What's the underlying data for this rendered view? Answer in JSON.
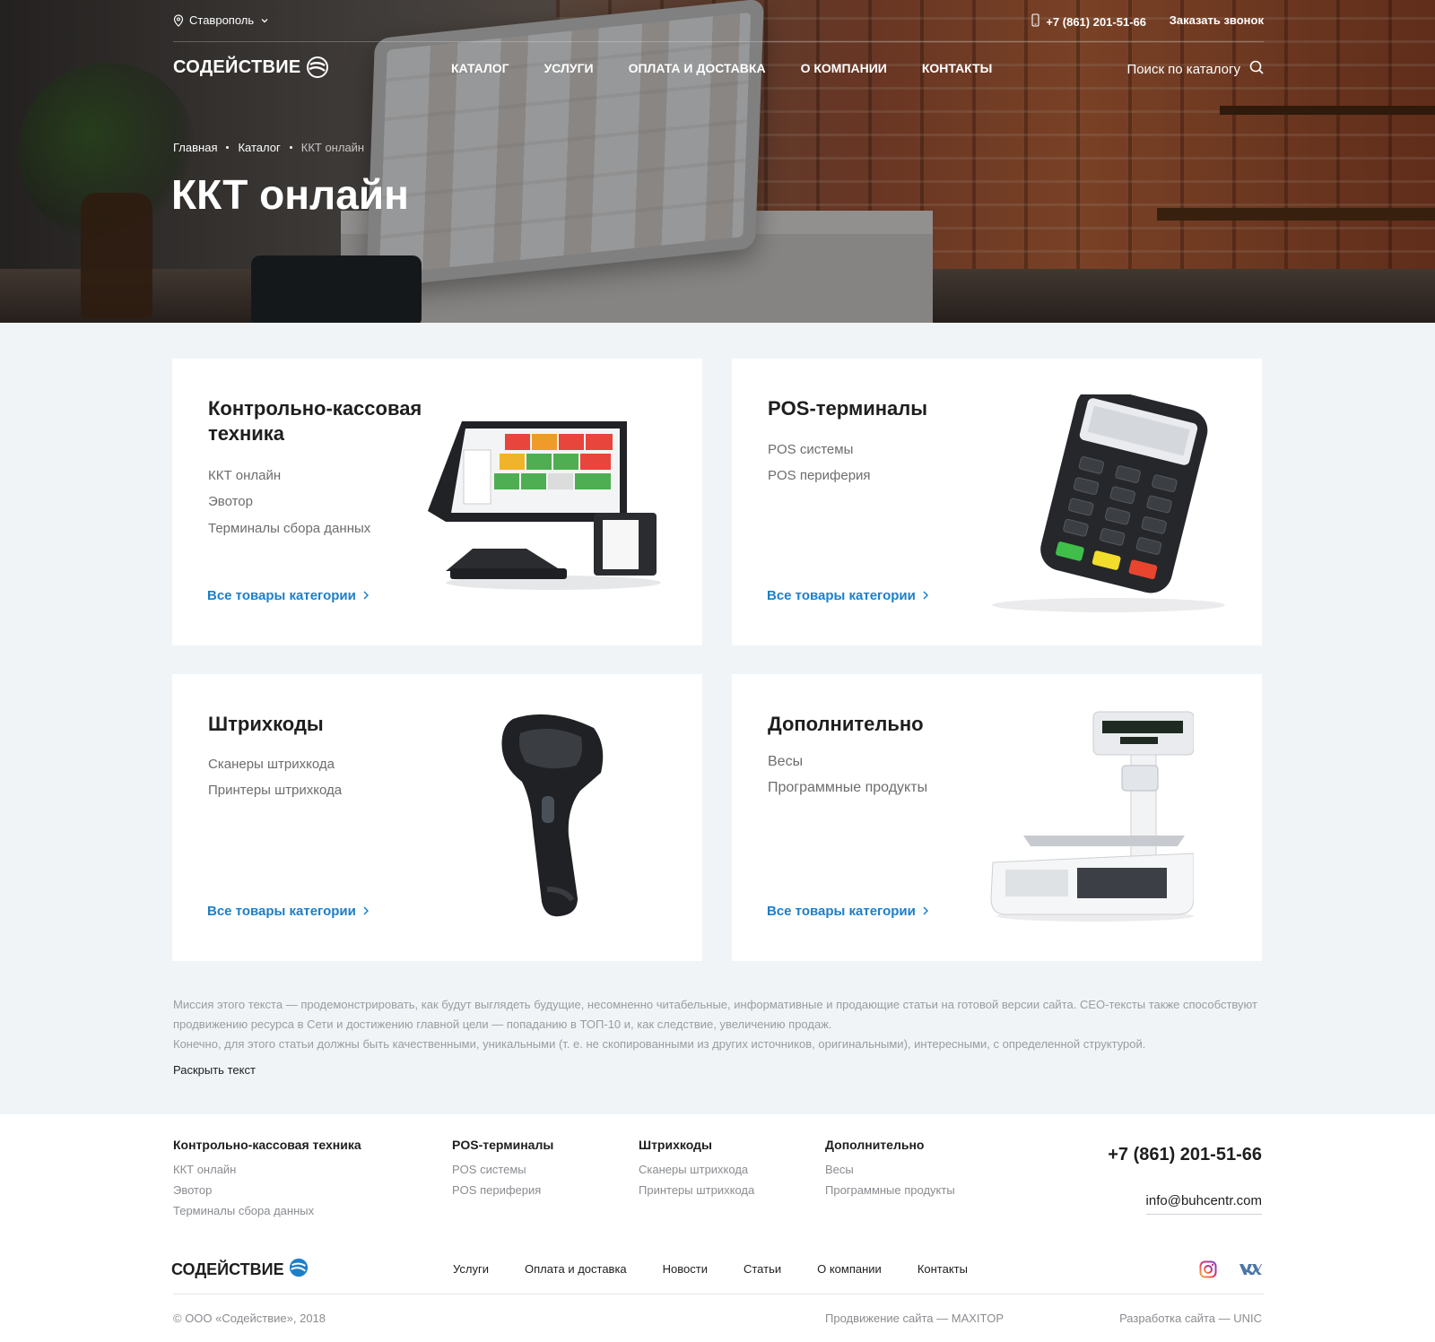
{
  "header": {
    "city": "Ставрополь",
    "phone": "+7 (861) 201-51-66",
    "callback_label": "Заказать звонок",
    "logo_text": "СОДЕЙСТВИЕ",
    "nav": [
      "КАТАЛОГ",
      "УСЛУГИ",
      "ОПЛАТА И ДОСТАВКА",
      "О КОМПАНИИ",
      "КОНТАКТЫ"
    ],
    "search_placeholder": "Поиск по каталогу"
  },
  "breadcrumb": [
    "Главная",
    "Каталог",
    "ККТ онлайн"
  ],
  "page_title": "ККТ онлайн",
  "cards": [
    {
      "title": "Контрольно-кассовая техника",
      "links": [
        "ККТ онлайн",
        "Эвотор",
        "Терминалы сбора данных"
      ],
      "more": "Все товары категории",
      "image": "pos-touch-terminal-icon"
    },
    {
      "title": "POS-терминалы",
      "links": [
        "POS системы",
        "POS периферия"
      ],
      "more": "Все товары категории",
      "image": "payment-terminal-icon"
    },
    {
      "title": "Штрихкоды",
      "links": [
        "Сканеры штрихкода",
        "Принтеры штрихкода"
      ],
      "more": "Все товары категории",
      "image": "barcode-scanner-icon"
    },
    {
      "title": "Дополнительно",
      "links": [
        "Весы",
        "Программные продукты"
      ],
      "more": "Все товары категории",
      "image": "scale-icon"
    }
  ],
  "seo": {
    "p1": "Миссия этого текста — продемонстрировать, как будут выглядеть будущие, несомненно читабельные, информативные и продающие статьи на готовой версии сайта. СЕО-тексты также способствуют продвижению ресурса в Сети и достижению главной цели — попаданию в ТОП-10 и, как следствие, увеличению продаж.",
    "p2": "Конечно, для этого статьи должны быть качественными, уникальными (т. е. не скопированными из других источников, оригинальными), интересными, с определенной структурой.",
    "expand": "Раскрыть текст"
  },
  "footer": {
    "columns": [
      {
        "title": "Контрольно-кассовая техника",
        "items": [
          "ККТ онлайн",
          "Эвотор",
          "Терминалы сбора данных"
        ]
      },
      {
        "title": "POS-терминалы",
        "items": [
          "POS системы",
          "POS периферия"
        ]
      },
      {
        "title": "Штрихкоды",
        "items": [
          "Сканеры штрихкода",
          "Принтеры штрихкода"
        ]
      },
      {
        "title": "Дополнительно",
        "items": [
          "Весы",
          "Программные продукты"
        ]
      }
    ],
    "phone": "+7 (861) 201-51-66",
    "email": "info@buhcentr.com",
    "logo_text": "СОДЕЙСТВИЕ",
    "nav": [
      "Услуги",
      "Оплата и доставка",
      "Новости",
      "Статьи",
      "О компании",
      "Контакты"
    ],
    "copyright": "© ООО «Содействие», 2018",
    "promo": "Продвижение сайта — MAXITOP",
    "dev": "Разработка сайта — UNIC",
    "social": [
      "instagram-icon",
      "vk-icon"
    ]
  },
  "colors": {
    "accent": "#1c7fc9",
    "background": "#f1f4f7",
    "text": "#1e1e1e",
    "muted": "#6d6d6d"
  }
}
